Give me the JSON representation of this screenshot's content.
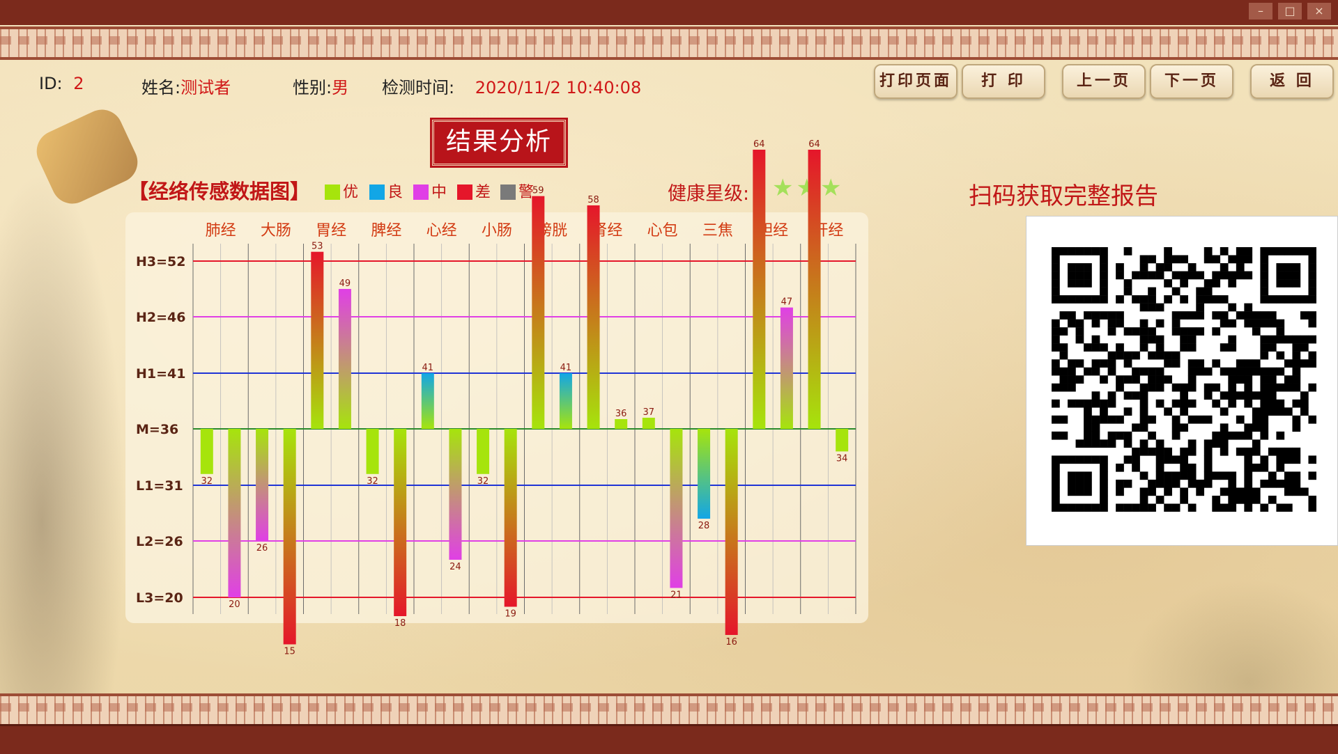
{
  "window": {
    "minimize": "–",
    "maximize": "□",
    "close": "×"
  },
  "header": {
    "id_label": "ID:",
    "id_value": "2",
    "name_label": "姓名:",
    "name_value": "测试者",
    "gender_label": "性别:",
    "gender_value": "男",
    "time_label": "检测时间:",
    "time_value": "2020/11/2 10:40:08"
  },
  "buttons": {
    "print_page": "打印页面",
    "print": "打 印",
    "prev": "上一页",
    "next": "下一页",
    "back": "返 回"
  },
  "result_title": "结果分析",
  "chart_title": "【经络传感数据图】",
  "legend": [
    {
      "label": "优",
      "color": "#a6e40c"
    },
    {
      "label": "良",
      "color": "#12a6e6"
    },
    {
      "label": "中",
      "color": "#e03fe6"
    },
    {
      "label": "差",
      "color": "#e5162a"
    },
    {
      "label": "警",
      "color": "#7a7a7a"
    }
  ],
  "health": {
    "label": "健康星级:",
    "stars": "★★★",
    "count": 3
  },
  "qr": {
    "label": "扫码获取完整报告"
  },
  "chart_data": {
    "type": "bar",
    "categories": [
      "肺经",
      "大肠",
      "胃经",
      "脾经",
      "心经",
      "小肠",
      "膀胱",
      "肾经",
      "心包",
      "三焦",
      "胆经",
      "肝经"
    ],
    "baseline": 36,
    "ylim": [
      20,
      53
    ],
    "reference_lines": [
      {
        "label": "H3=52",
        "value": 52,
        "color": "#e5162a"
      },
      {
        "label": "H2=46",
        "value": 46,
        "color": "#e03fe6"
      },
      {
        "label": "H1=41",
        "value": 41,
        "color": "#1f34d6"
      },
      {
        "label": "M=36",
        "value": 36,
        "color": "#2a8a2a"
      },
      {
        "label": "L1=31",
        "value": 31,
        "color": "#1f34d6"
      },
      {
        "label": "L2=26",
        "value": 26,
        "color": "#e03fe6"
      },
      {
        "label": "L3=20",
        "value": 20,
        "color": "#e5162a"
      }
    ],
    "series": [
      {
        "values": [
          32,
          26,
          53,
          32,
          41,
          32,
          59,
          58,
          37,
          28,
          64,
          64
        ]
      },
      {
        "values": [
          20,
          15,
          49,
          18,
          24,
          19,
          41,
          36,
          21,
          16,
          47,
          34
        ]
      }
    ]
  }
}
